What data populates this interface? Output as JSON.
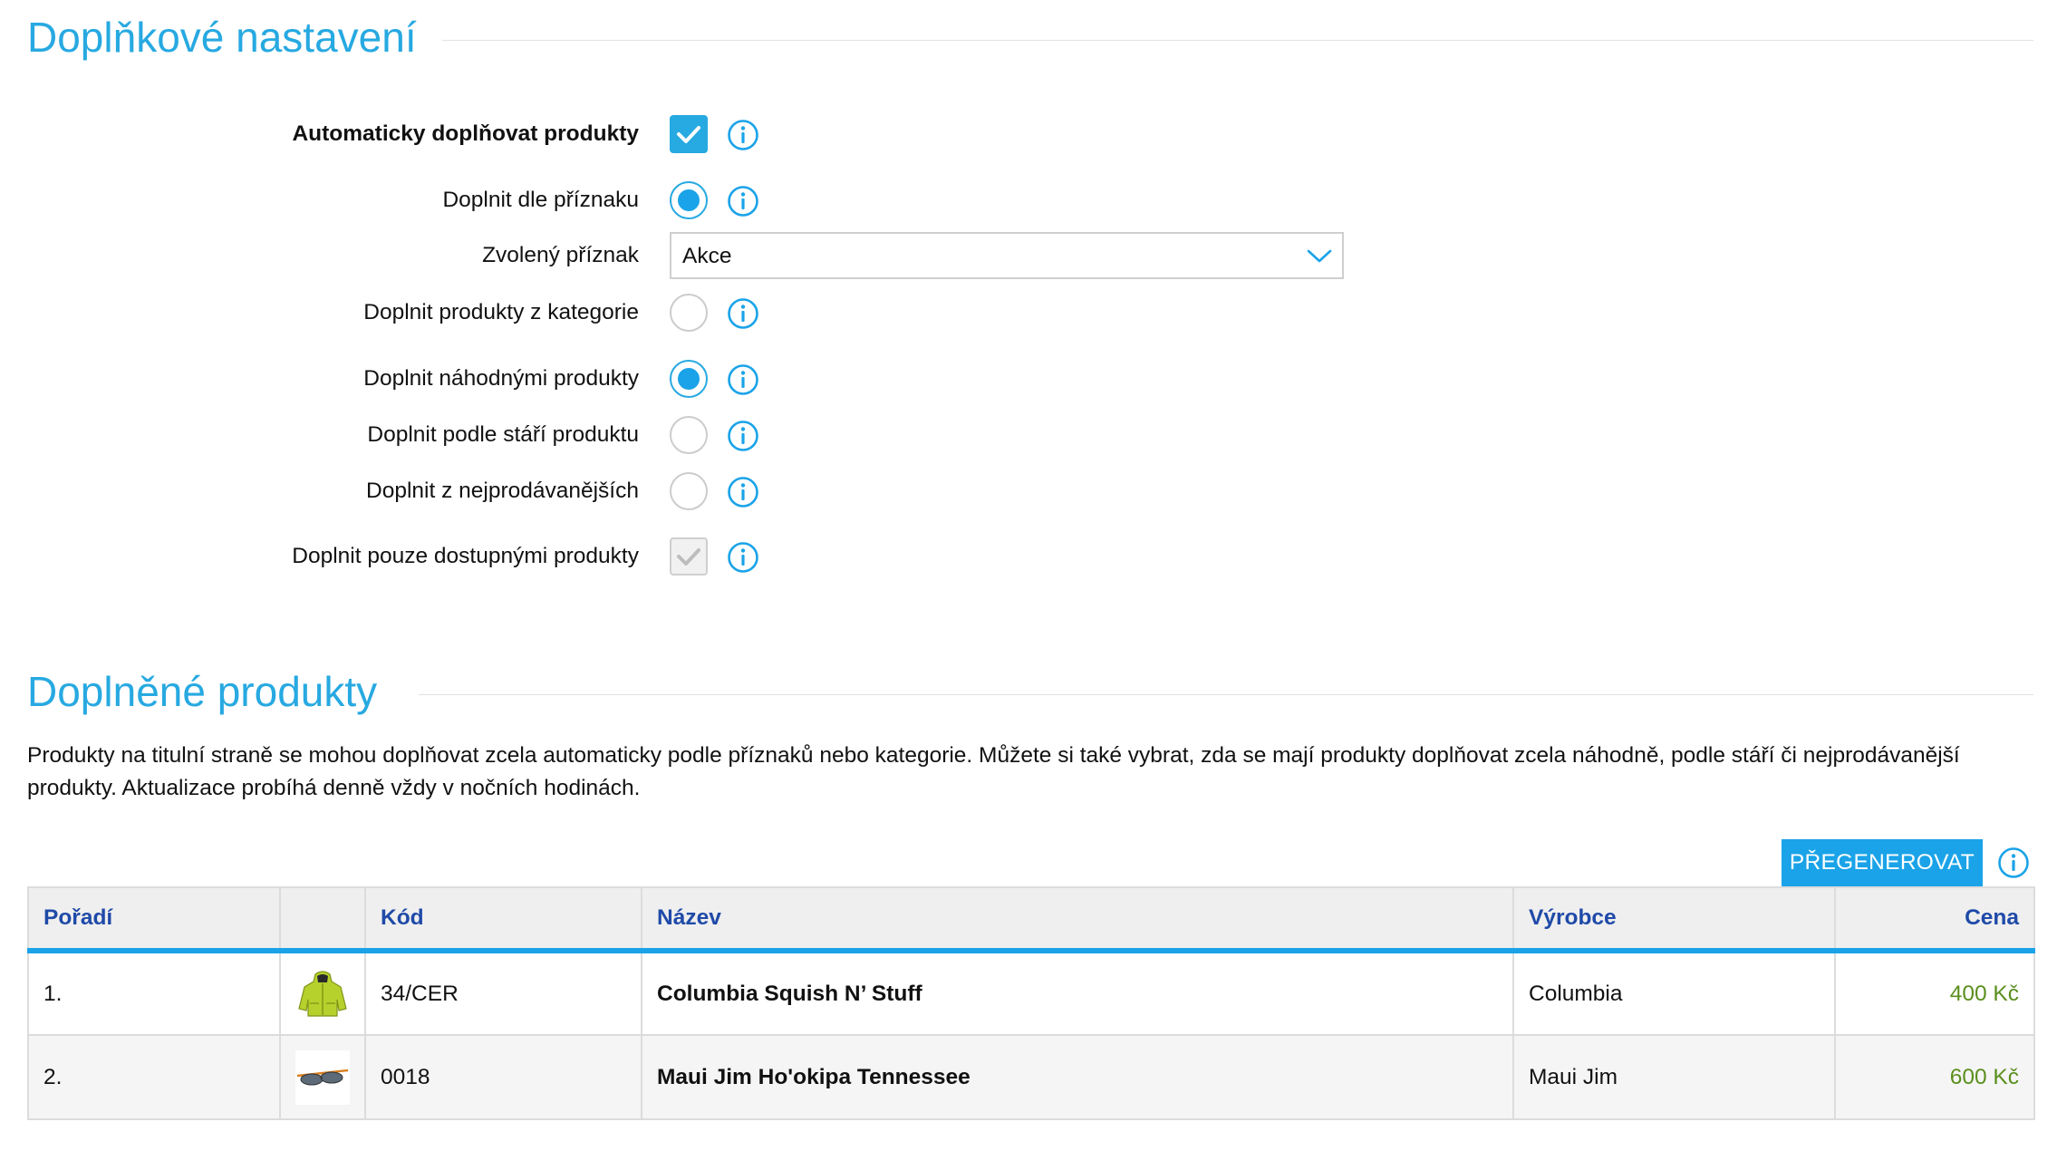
{
  "settings_section": {
    "title": "Doplňkové nastavení",
    "rows": {
      "auto_fill": {
        "label": "Automaticky doplňovat produkty",
        "checked": true
      },
      "fill_by_flag": {
        "label": "Doplnit dle příznaku",
        "selected": true
      },
      "selected_flag": {
        "label": "Zvolený příznak",
        "value": "Akce"
      },
      "fill_from_category": {
        "label": "Doplnit produkty z kategorie",
        "selected": false
      },
      "fill_random": {
        "label": "Doplnit náhodnými produkty",
        "selected": true
      },
      "fill_by_age": {
        "label": "Doplnit podle stáří produktu",
        "selected": false
      },
      "fill_bestsellers": {
        "label": "Doplnit z nejprodávanějších",
        "selected": false
      },
      "fill_available_only": {
        "label": "Doplnit pouze dostupnými produkty",
        "checked": true,
        "disabled": true
      }
    }
  },
  "products_section": {
    "title": "Doplněné produkty",
    "description": "Produkty na titulní straně se mohou doplňovat zcela automaticky podle příznaků nebo kategorie. Můžete si také vybrat, zda se mají produkty doplňovat zcela náhodně, podle stáří či nejprodávanější produkty. Aktualizace probíhá denně vždy v nočních hodinách.",
    "regenerate_label": "PŘEGENEROVAT",
    "table": {
      "columns": [
        "Pořadí",
        "",
        "Kód",
        "Název",
        "Výrobce",
        "Cena"
      ],
      "rows": [
        {
          "order": "1.",
          "image": "green-jacket-thumbnail",
          "code": "34/CER",
          "name": "Columbia Squish N’ Stuff",
          "manufacturer": "Columbia",
          "price": "400 Kč"
        },
        {
          "order": "2.",
          "image": "sunglasses-thumbnail",
          "code": "0018",
          "name": "Maui Jim Ho'okipa Tennessee",
          "manufacturer": "Maui Jim",
          "price": "600 Kč"
        }
      ]
    }
  },
  "colors": {
    "accent": "#27a9e1",
    "header_text": "#1f4aa8",
    "price": "#5a8f1d"
  },
  "icons": {
    "info": "info-circle-icon",
    "chevron": "chevron-down-icon",
    "check": "checkmark-icon"
  }
}
